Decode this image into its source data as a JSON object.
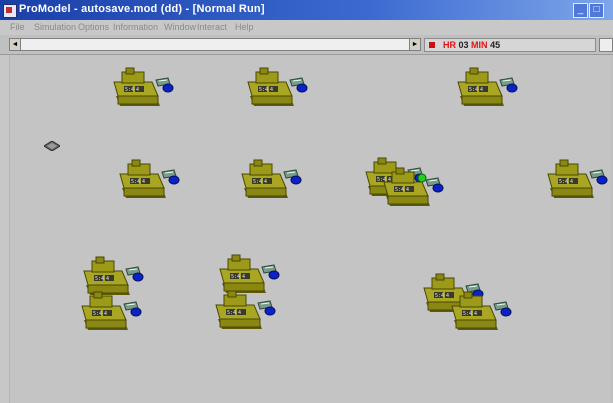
{
  "window": {
    "title": "ProModel - autosave.mod (dd) - [Normal Run]",
    "minimize": "_",
    "maximize": "□"
  },
  "menu": [
    "File",
    "Simulation",
    "Options",
    "Information",
    "Window",
    "Interact",
    "Help"
  ],
  "toolbar": {
    "scroll_left": "◄",
    "scroll_right": "►"
  },
  "clock": {
    "hr_label": "HR",
    "hr_value": "03",
    "min_label": "MIN",
    "min_value": "45"
  },
  "machines": [
    {
      "id": "m1"
    },
    {
      "id": "m2"
    },
    {
      "id": "m3"
    },
    {
      "id": "m4"
    },
    {
      "id": "m5"
    },
    {
      "id": "m6"
    },
    {
      "id": "m7"
    },
    {
      "id": "m8"
    },
    {
      "id": "m9"
    },
    {
      "id": "m10"
    },
    {
      "id": "m11"
    },
    {
      "id": "m12"
    },
    {
      "id": "m13"
    },
    {
      "id": "m14"
    },
    {
      "id": "m15"
    }
  ],
  "colors": {
    "machine_body": "#9c9a18",
    "machine_shadow": "#5e5c08",
    "screen_text": "#e8e8e8",
    "part_blue": "#0b22c8",
    "active_green": "#22cc22"
  }
}
